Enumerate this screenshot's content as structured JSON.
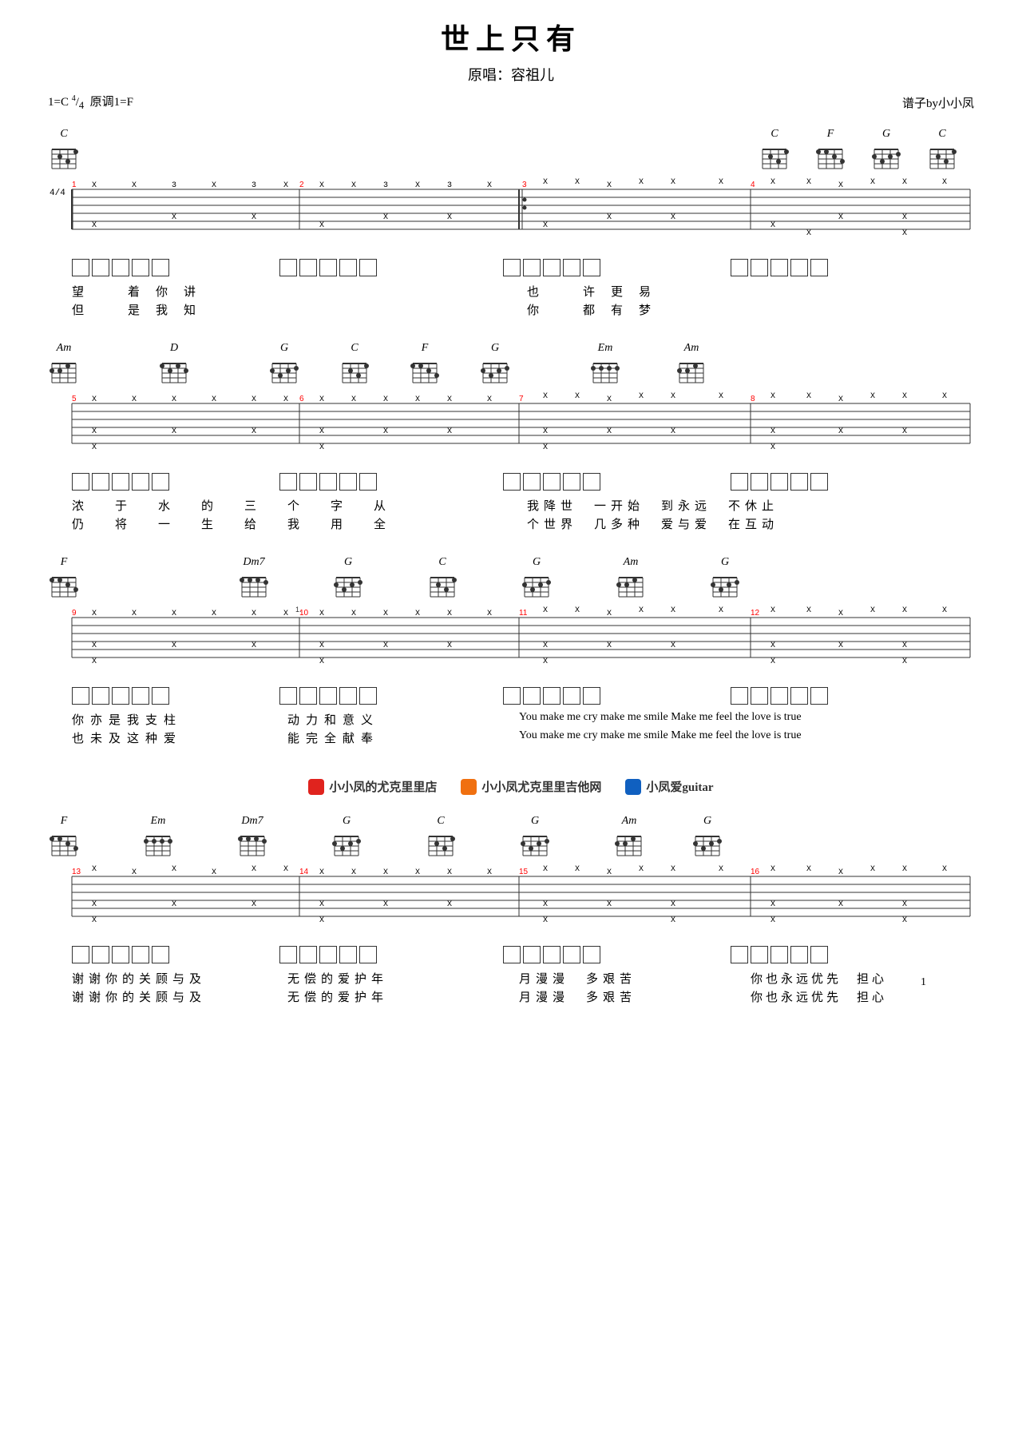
{
  "page": {
    "title": "世上只有",
    "subtitle": "原唱：容祖儿",
    "key_info": "1=C",
    "time_sig": "4/4",
    "original_key": "原调1=F",
    "author": "谱子by小小凤",
    "page_number": "1"
  },
  "sections": [
    {
      "id": "section1",
      "chords": [
        "C"
      ],
      "chord_positions": [
        0
      ],
      "lyrics_line1": "望　着你讲",
      "lyrics_line2": "但　是我知"
    },
    {
      "id": "section2",
      "chords": [
        "C",
        "F",
        "G",
        "C"
      ],
      "lyrics_line1": "也　许更易",
      "lyrics_line2": "你　都有梦"
    },
    {
      "id": "section3",
      "chords": [
        "Am",
        "D",
        "G",
        "C",
        "F",
        "G",
        "Em",
        "Am"
      ],
      "lyrics_line1_a": "浓　于　水　的　三　个　字　从",
      "lyrics_line1_b": "我降　世　一开　始　到永　远　不休止",
      "lyrics_line2_a": "仍　将　一　生　给　我　用　全",
      "lyrics_line2_b": "个世界　几多种　爱与爱　在互动"
    },
    {
      "id": "section4",
      "chords": [
        "F",
        "Dm7",
        "G",
        "C",
        "G",
        "Am",
        "G"
      ],
      "lyrics_line1": "你亦是我支柱　动力和意义　You make me cry make me smile Make me feel the love is true",
      "lyrics_line2": "也未及这种爱　能完全献奉　You make me cry make me smile Make me feel the love is true"
    },
    {
      "id": "section5",
      "chords": [
        "F",
        "Em",
        "Dm7",
        "G",
        "C",
        "G",
        "Am",
        "G"
      ],
      "lyrics_line1": "谢谢你的关顾与及　无偿的爱护年　月漫漫　多艰苦　你也永远优先　担心",
      "lyrics_line2": "谢谢你的关顾与及　无偿的爱护年　月漫漫　多艰苦　你也永远优先　担心"
    }
  ],
  "brand": {
    "items": [
      {
        "icon_color": "red",
        "text": "小小凤的尤克里里店"
      },
      {
        "icon_color": "orange",
        "text": "小小凤尤克里里吉他网"
      },
      {
        "icon_color": "blue",
        "text": "小凤爱guitar"
      }
    ]
  }
}
